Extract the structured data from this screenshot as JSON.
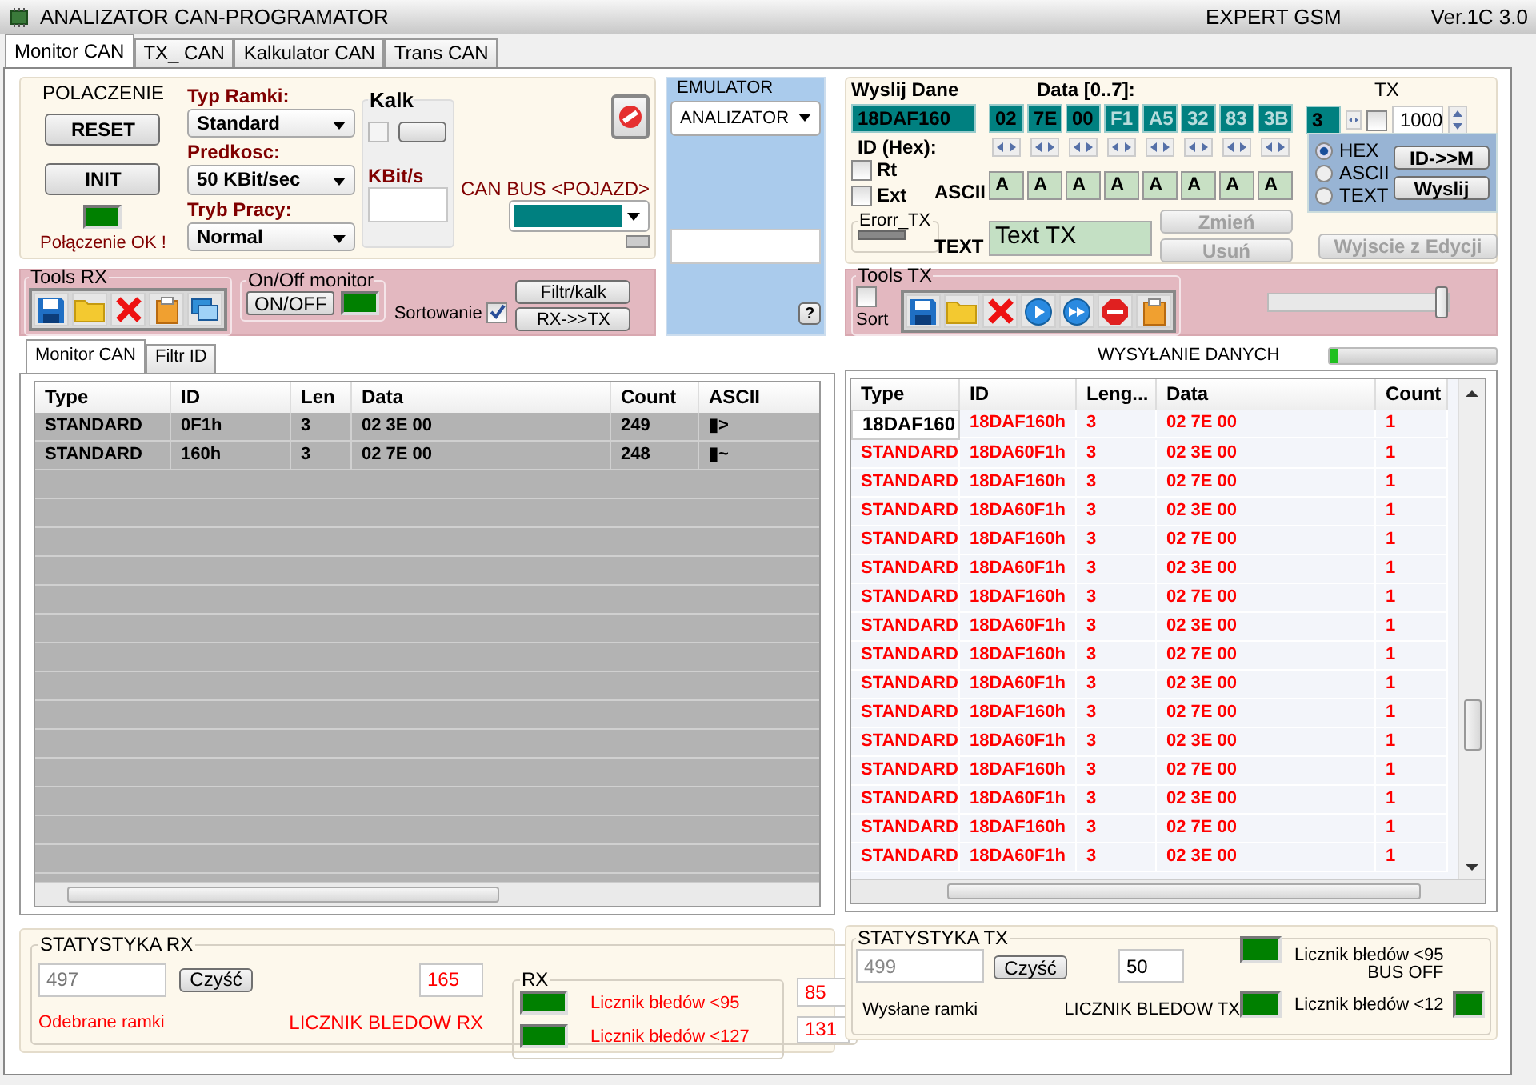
{
  "window": {
    "title": "ANALIZATOR CAN-PROGRAMATOR",
    "subtitle": "EXPERT GSM",
    "version": "Ver.1C 3.0"
  },
  "tabs": [
    {
      "label": "Monitor CAN",
      "selected": true
    },
    {
      "label": "TX_ CAN",
      "selected": false
    },
    {
      "label": "Kalkulator CAN",
      "selected": false
    },
    {
      "label": "Trans CAN",
      "selected": false
    }
  ],
  "connection": {
    "title": "POLACZENIE",
    "buttons": [
      "RESET",
      "INIT"
    ],
    "status": "Połączenie OK !"
  },
  "frame_settings": [
    {
      "label": "Typ Ramki:",
      "value": "Standard"
    },
    {
      "label": "Predkosc:",
      "value": "50 KBit/sec"
    },
    {
      "label": "Tryb Pracy:",
      "value": "Normal"
    }
  ],
  "kalk": {
    "title": "Kalk",
    "checked": false,
    "unit": "KBit/s"
  },
  "can_bus": {
    "label": "CAN BUS <POJAZD>"
  },
  "emulator": {
    "title": "EMULATOR",
    "mode": "ANALIZATOR",
    "help": "?"
  },
  "tools_rx": {
    "title": "Tools RX",
    "monitor_title": "On/Off monitor",
    "toggle": "ON/OFF",
    "sort_label": "Sortowanie",
    "sort_checked": true,
    "buttons": [
      "Filtr/kalk",
      "RX->>TX"
    ]
  },
  "rx_tabs": [
    {
      "label": "Monitor CAN",
      "selected": true
    },
    {
      "label": "Filtr ID",
      "selected": false
    }
  ],
  "rx_table": {
    "columns": [
      "Type",
      "ID",
      "Len",
      "Data",
      "Count",
      "ASCII"
    ],
    "rows": [
      [
        "STANDARD",
        "0F1h",
        "3",
        "02 3E 00",
        "249",
        "▮>"
      ],
      [
        "STANDARD",
        "160h",
        "3",
        "02 7E 00",
        "248",
        "▮~"
      ]
    ]
  },
  "send": {
    "title": "Wyslij Dane",
    "data_label": "Data [0..7]:",
    "tx_label": "TX",
    "id": "18DAF160",
    "id_label": "ID (Hex):",
    "data": [
      {
        "value": "02",
        "active": true
      },
      {
        "value": "7E",
        "active": true
      },
      {
        "value": "00",
        "active": true
      },
      {
        "value": "F1",
        "active": false
      },
      {
        "value": "A5",
        "active": false
      },
      {
        "value": "32",
        "active": false
      },
      {
        "value": "83",
        "active": false
      },
      {
        "value": "3B",
        "active": false
      }
    ],
    "length": "3",
    "tx_checked": false,
    "interval": "1000",
    "rt_label": "Rt",
    "rt_checked": false,
    "ext_label": "Ext",
    "ext_checked": false,
    "error_label": "Erorr_TX",
    "ascii_label": "ASCII",
    "ascii": [
      "A",
      "A",
      "A",
      "A",
      "A",
      "A",
      "A",
      "A"
    ],
    "text_label": "TEXT",
    "text": "Text TX",
    "edit_buttons": [
      "Zmień",
      "Usuń"
    ],
    "modes": [
      {
        "label": "HEX",
        "selected": true
      },
      {
        "label": "ASCII",
        "selected": false
      },
      {
        "label": "TEXT",
        "selected": false
      }
    ],
    "actions": [
      "ID->>M",
      "Wyslij"
    ],
    "exit": "Wyjscie z Edycji"
  },
  "tools_tx": {
    "title": "Tools TX",
    "sort_label": "Sort",
    "sort_checked": false,
    "slider": {
      "level": 1
    }
  },
  "sending": {
    "label": "WYSYŁANIE DANYCH",
    "level": 0.05
  },
  "tx_table": {
    "columns": [
      "Type",
      "ID",
      "Leng...",
      "Data",
      "Count"
    ],
    "rows": [
      {
        "editing": true,
        "cells": [
          "18DAF160",
          "18DAF160h",
          "3",
          "02 7E 00",
          "1"
        ]
      },
      {
        "editing": false,
        "cells": [
          "STANDARD",
          "18DA60F1h",
          "3",
          "02 3E 00",
          "1"
        ]
      },
      {
        "editing": false,
        "cells": [
          "STANDARD",
          "18DAF160h",
          "3",
          "02 7E 00",
          "1"
        ]
      },
      {
        "editing": false,
        "cells": [
          "STANDARD",
          "18DA60F1h",
          "3",
          "02 3E 00",
          "1"
        ]
      },
      {
        "editing": false,
        "cells": [
          "STANDARD",
          "18DAF160h",
          "3",
          "02 7E 00",
          "1"
        ]
      },
      {
        "editing": false,
        "cells": [
          "STANDARD",
          "18DA60F1h",
          "3",
          "02 3E 00",
          "1"
        ]
      },
      {
        "editing": false,
        "cells": [
          "STANDARD",
          "18DAF160h",
          "3",
          "02 7E 00",
          "1"
        ]
      },
      {
        "editing": false,
        "cells": [
          "STANDARD",
          "18DA60F1h",
          "3",
          "02 3E 00",
          "1"
        ]
      },
      {
        "editing": false,
        "cells": [
          "STANDARD",
          "18DAF160h",
          "3",
          "02 7E 00",
          "1"
        ]
      },
      {
        "editing": false,
        "cells": [
          "STANDARD",
          "18DA60F1h",
          "3",
          "02 3E 00",
          "1"
        ]
      },
      {
        "editing": false,
        "cells": [
          "STANDARD",
          "18DAF160h",
          "3",
          "02 7E 00",
          "1"
        ]
      },
      {
        "editing": false,
        "cells": [
          "STANDARD",
          "18DA60F1h",
          "3",
          "02 3E 00",
          "1"
        ]
      },
      {
        "editing": false,
        "cells": [
          "STANDARD",
          "18DAF160h",
          "3",
          "02 7E 00",
          "1"
        ]
      },
      {
        "editing": false,
        "cells": [
          "STANDARD",
          "18DA60F1h",
          "3",
          "02 3E 00",
          "1"
        ]
      },
      {
        "editing": false,
        "cells": [
          "STANDARD",
          "18DAF160h",
          "3",
          "02 7E 00",
          "1"
        ]
      },
      {
        "editing": false,
        "cells": [
          "STANDARD",
          "18DA60F1h",
          "3",
          "02 3E 00",
          "1"
        ]
      }
    ]
  },
  "stats_rx": {
    "title": "STATYSTYKA RX",
    "received": "497",
    "clear": "Czyść",
    "received_label": "Odebrane ramki",
    "errors": "165",
    "errors_label": "LICZNIK BLEDOW RX",
    "group": "RX",
    "counters": [
      {
        "label": "Licznik błedów <95",
        "value": "85"
      },
      {
        "label": "Licznik błedów <127",
        "value": "131"
      }
    ]
  },
  "stats_tx": {
    "title": "STATYSTYKA TX",
    "sent": "499",
    "clear": "Czyść",
    "sent_label": "Wysłane ramki",
    "errors": "50",
    "errors_label": "LICZNIK BLEDOW TX",
    "bus_off": "BUS OFF",
    "counters": [
      {
        "label": "Licznik błedów <95"
      },
      {
        "label": "Licznik błedów <12"
      }
    ]
  }
}
